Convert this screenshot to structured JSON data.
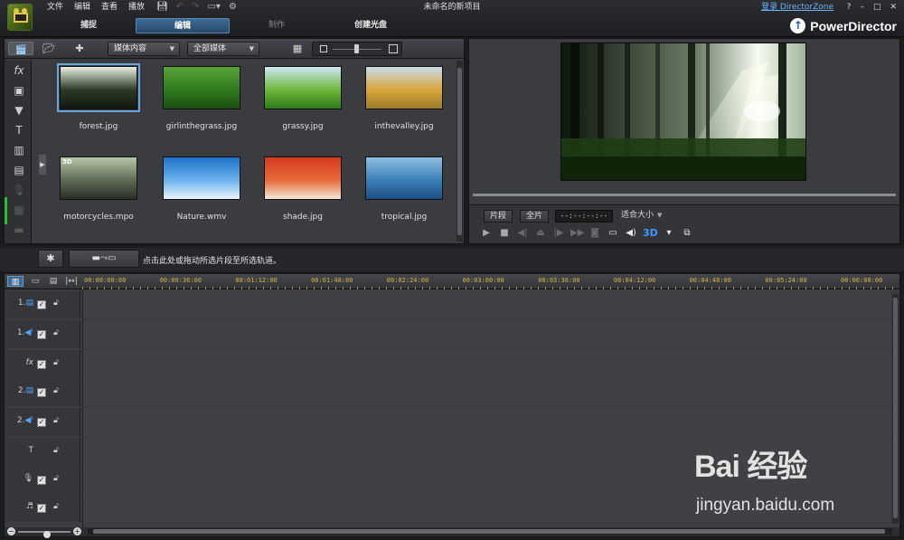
{
  "menu": [
    "文件",
    "编辑",
    "查看",
    "播放"
  ],
  "quick_icons": [
    "save-icon",
    "undo-icon",
    "redo-icon",
    "display-mode-icon",
    "settings-icon"
  ],
  "project_title": "未命名的新项目",
  "login_link": "登录 DirectorZone",
  "window_controls": [
    "?",
    "–",
    "□",
    "✕"
  ],
  "modes": [
    {
      "label": "捕捉",
      "state": "normal"
    },
    {
      "label": "编辑",
      "state": "active"
    },
    {
      "label": "制作",
      "state": "disabled"
    },
    {
      "label": "创建光盘",
      "state": "normal"
    }
  ],
  "brand": "PowerDirector",
  "library": {
    "filter_content": "媒体内容",
    "filter_type": "全部媒体",
    "items": [
      {
        "name": "forest.jpg",
        "selected": true,
        "thumb": [
          "#e8f0e0",
          "#2c3a26",
          "#11180f"
        ]
      },
      {
        "name": "girlinthegrass.jpg",
        "selected": false,
        "thumb": [
          "#5aa33a",
          "#2f7a1e",
          "#1b4f11"
        ]
      },
      {
        "name": "grassy.jpg",
        "selected": false,
        "thumb": [
          "#cfe8f5",
          "#6fb83b",
          "#2d7a1b"
        ]
      },
      {
        "name": "inthevalley.jpg",
        "selected": false,
        "thumb": [
          "#c9dbe8",
          "#d9a63b",
          "#9a7a2a"
        ]
      },
      {
        "name": "motorcycles.mpo",
        "selected": false,
        "badge": "3D",
        "thumb": [
          "#b7c7a8",
          "#5e6a55",
          "#2a2f26"
        ]
      },
      {
        "name": "Nature.wmv",
        "selected": false,
        "thumb": [
          "#1e73c8",
          "#6bb2ec",
          "#e9f4fb"
        ]
      },
      {
        "name": "shade.jpg",
        "selected": false,
        "thumb": [
          "#d33a1e",
          "#e86a3a",
          "#f3e8d8"
        ]
      },
      {
        "name": "tropical.jpg",
        "selected": false,
        "thumb": [
          "#8fbfe0",
          "#3a7fb8",
          "#1e4f82"
        ]
      }
    ]
  },
  "preview": {
    "clip_button": "片段",
    "movie_button": "全片",
    "timecode": "--:--:--:--",
    "fit_size": "适合大小",
    "player_icons": [
      "play-icon",
      "stop-icon",
      "prev-frame-icon",
      "split-icon",
      "next-frame-icon",
      "fast-forward-icon",
      "snapshot-icon",
      "dual-monitor-icon",
      "volume-icon",
      "3d-icon",
      "3d-dropdown-icon",
      "undock-icon"
    ],
    "three_d_label": "3D"
  },
  "mid_strip": {
    "insert_label": "▬⤳▭",
    "drop_hint": "点击此处或拖动所选片段至所选轨道。"
  },
  "timeline": {
    "ruler_labels": [
      "00:00:00:00",
      "00:00:36:00",
      "00:01:12:00",
      "00:01:48:00",
      "00:02:24:00",
      "00:03:00:00",
      "00:03:36:00",
      "00:04:12:00",
      "00:04:48:00",
      "00:05:24:00",
      "00:06:00:00"
    ],
    "tracks": [
      {
        "label_num": "1.",
        "icon": "video-track-icon",
        "glyph": "▤",
        "checked": true,
        "name": "video-track-1"
      },
      {
        "label_num": "1.",
        "icon": "audio-track-icon",
        "glyph": "◀ᵗ",
        "checked": true,
        "name": "audio-track-1"
      },
      {
        "label_num": "",
        "icon": "fx-track-icon",
        "glyph": "fx",
        "checked": true,
        "name": "effect-track"
      },
      {
        "label_num": "2.",
        "icon": "video-track-icon",
        "glyph": "▤",
        "checked": true,
        "name": "video-track-2"
      },
      {
        "label_num": "2.",
        "icon": "audio-track-icon",
        "glyph": "◀ᵗ",
        "checked": true,
        "name": "audio-track-2"
      },
      {
        "label_num": "",
        "icon": "title-track-icon",
        "glyph": "T",
        "checked": false,
        "name": "title-track"
      },
      {
        "label_num": "",
        "icon": "voice-track-icon",
        "glyph": "🎙",
        "checked": true,
        "name": "voice-track"
      },
      {
        "label_num": "",
        "icon": "music-track-icon",
        "glyph": "♬",
        "checked": true,
        "name": "music-track"
      }
    ],
    "zoom_level": 0.55
  },
  "watermark": {
    "text": "Bai 经验",
    "url": "jingyan.baidu.com"
  },
  "colors": {
    "accent": "#3f6d95",
    "link": "#6cb4ff",
    "ruler": "#d4b24a",
    "three_d": "#3c9cff",
    "active_indicator": "#26c235"
  }
}
